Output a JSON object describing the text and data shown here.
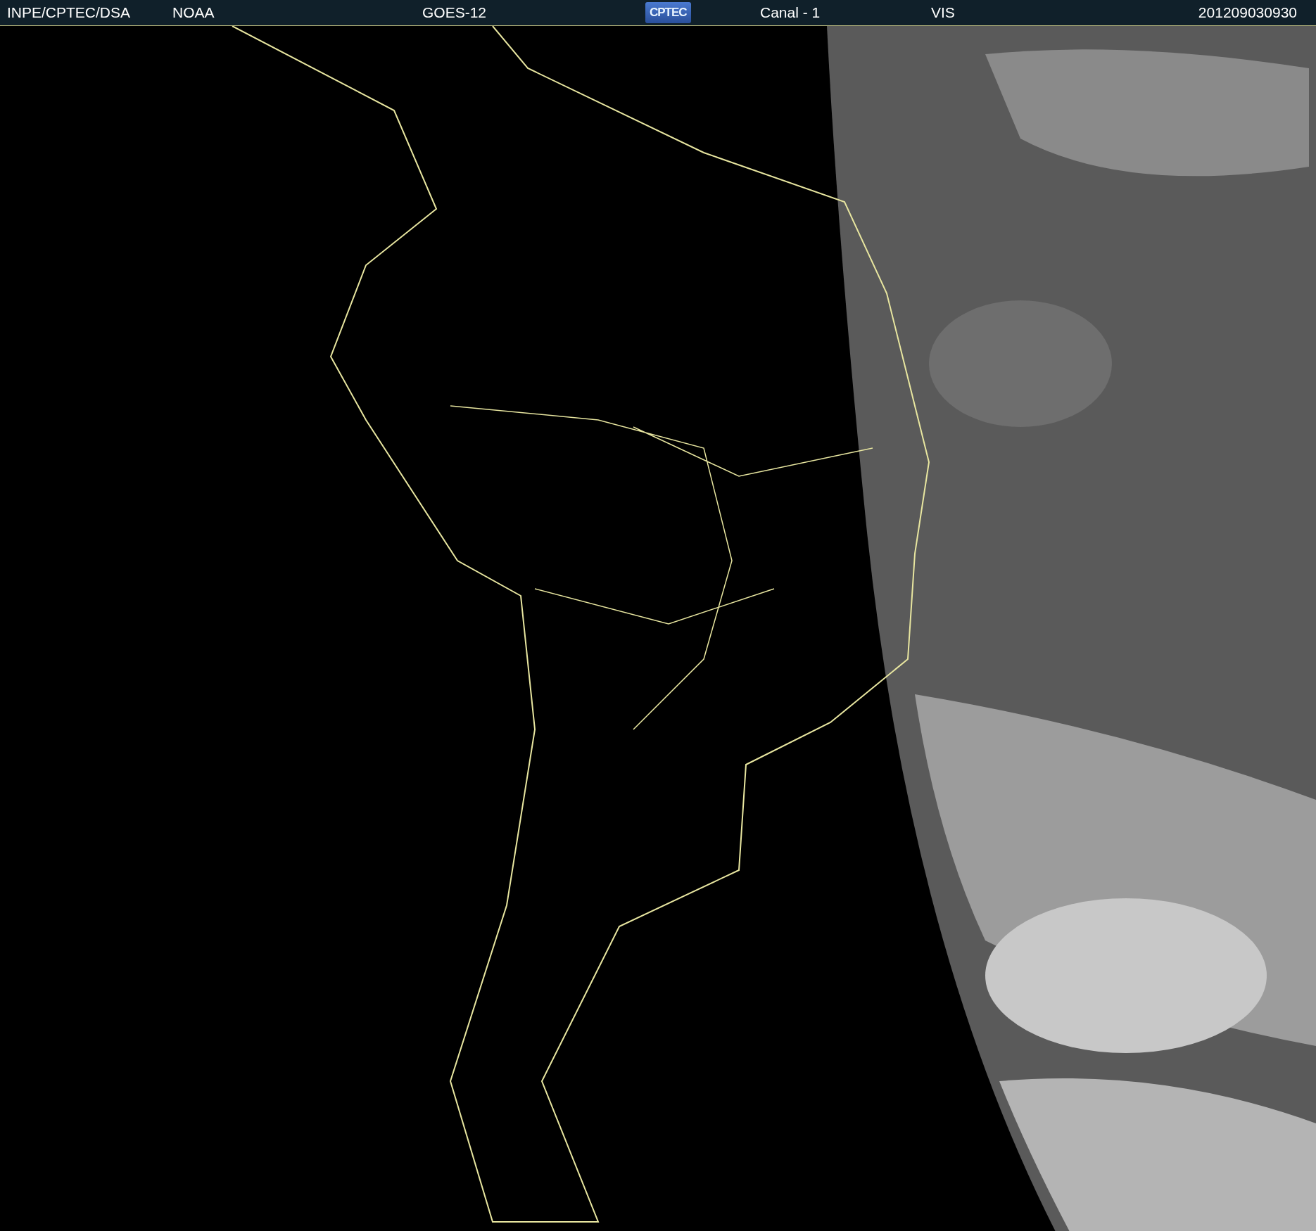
{
  "header": {
    "source": "INPE/CPTEC/DSA",
    "agency": "NOAA",
    "satellite": "GOES-12",
    "logo": "CPTEC",
    "channel": "Canal - 1",
    "band": "VIS",
    "timestamp": "201209030930"
  }
}
